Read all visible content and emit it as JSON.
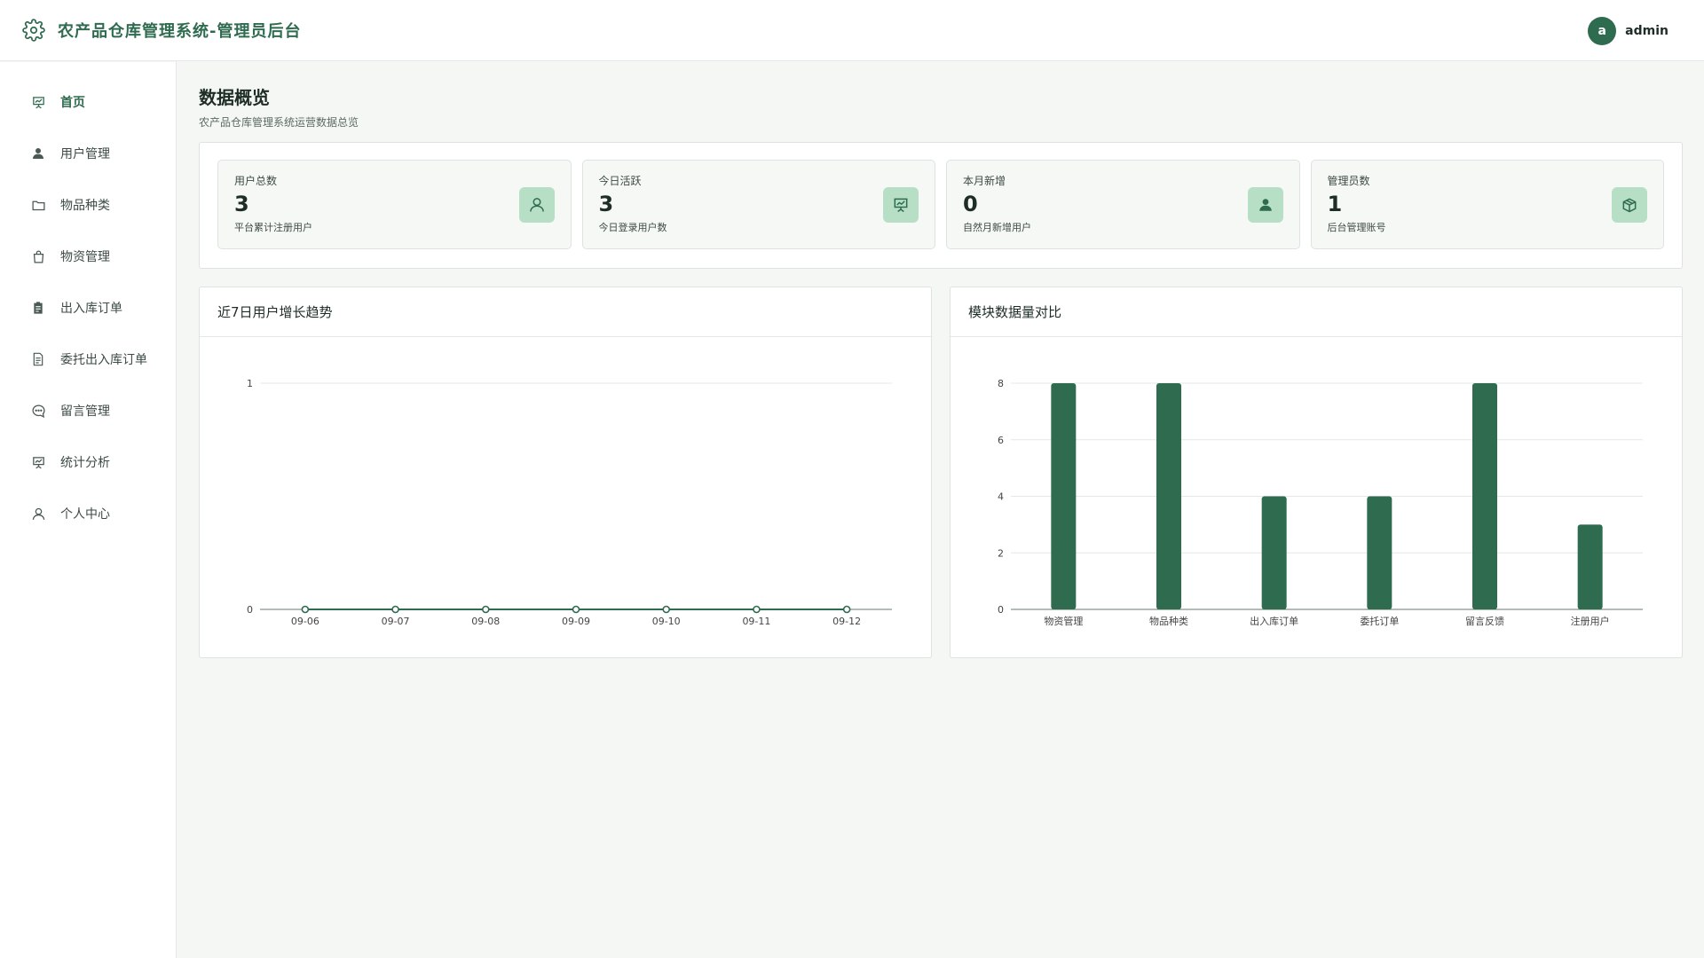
{
  "header": {
    "title": "农产品仓库管理系统-管理员后台",
    "avatar_letter": "a",
    "username": "admin"
  },
  "sidebar": {
    "items": [
      {
        "label": "首页",
        "icon": "chart-presentation-icon",
        "active": true
      },
      {
        "label": "用户管理",
        "icon": "user-icon"
      },
      {
        "label": "物品种类",
        "icon": "folder-icon"
      },
      {
        "label": "物资管理",
        "icon": "shopping-bag-icon"
      },
      {
        "label": "出入库订单",
        "icon": "clipboard-icon"
      },
      {
        "label": "委托出入库订单",
        "icon": "document-icon"
      },
      {
        "label": "留言管理",
        "icon": "chat-bubble-icon"
      },
      {
        "label": "统计分析",
        "icon": "chart-presentation-icon"
      },
      {
        "label": "个人中心",
        "icon": "user-outline-icon"
      }
    ]
  },
  "page": {
    "title": "数据概览",
    "subtitle": "农产品仓库管理系统运营数据总览"
  },
  "stats": [
    {
      "label": "用户总数",
      "value": "3",
      "desc": "平台累计注册用户",
      "icon": "user-outline-icon"
    },
    {
      "label": "今日活跃",
      "value": "3",
      "desc": "今日登录用户数",
      "icon": "chart-presentation-icon"
    },
    {
      "label": "本月新增",
      "value": "0",
      "desc": "自然月新增用户",
      "icon": "user-icon"
    },
    {
      "label": "管理员数",
      "value": "1",
      "desc": "后台管理账号",
      "icon": "box-icon"
    }
  ],
  "colors": {
    "accent": "#2f6b4f",
    "icon_bg": "#b6dfc5",
    "grid": "#e3e8e4"
  },
  "chart_data": [
    {
      "type": "line",
      "title": "近7日用户增长趋势",
      "x": [
        "09-06",
        "09-07",
        "09-08",
        "09-09",
        "09-10",
        "09-11",
        "09-12"
      ],
      "series": [
        {
          "values": [
            0,
            0,
            0,
            0,
            0,
            0,
            0
          ]
        }
      ],
      "ylim": [
        0,
        1
      ],
      "yticks": [
        0,
        1
      ],
      "grid": true
    },
    {
      "type": "bar",
      "title": "模块数据量对比",
      "categories": [
        "物资管理",
        "物品种类",
        "出入库订单",
        "委托订单",
        "留言反馈",
        "注册用户"
      ],
      "values": [
        8,
        8,
        4,
        4,
        8,
        3
      ],
      "ylim": [
        0,
        8
      ],
      "yticks": [
        0,
        2,
        4,
        6,
        8
      ],
      "grid": true
    }
  ]
}
